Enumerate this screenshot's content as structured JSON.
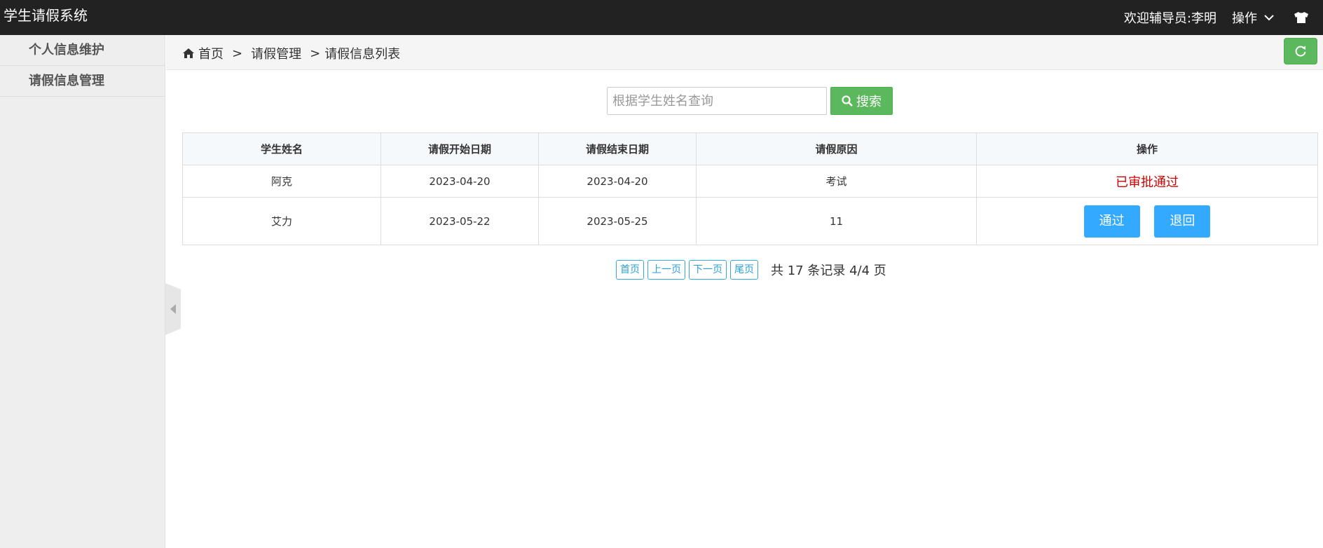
{
  "app": {
    "title": "学生请假系统"
  },
  "topbar": {
    "welcome": "欢迎辅导员:李明",
    "ops_label": "操作",
    "ops_icon": "chevron-down-icon",
    "theme_icon": "tshirt-icon"
  },
  "sidebar": {
    "items": [
      {
        "label": "个人信息维护"
      },
      {
        "label": "请假信息管理"
      }
    ]
  },
  "breadcrumb": {
    "home": "首页",
    "sep1": ">",
    "level2": "请假管理",
    "sep2": ">",
    "level3": "请假信息列表"
  },
  "search": {
    "placeholder": "根据学生姓名查询",
    "value": "",
    "button_label": "搜索"
  },
  "table": {
    "headers": [
      "学生姓名",
      "请假开始日期",
      "请假结束日期",
      "请假原因",
      "操作"
    ],
    "rows": [
      {
        "name": "阿克",
        "start": "2023-04-20",
        "end": "2023-04-20",
        "reason": "考试",
        "status": "已审批通过"
      },
      {
        "name": "艾力",
        "start": "2023-05-22",
        "end": "2023-05-25",
        "reason": "11",
        "approve": "通过",
        "reject": "退回"
      }
    ]
  },
  "pagination": {
    "first": "首页",
    "prev": "上一页",
    "next": "下一页",
    "last": "尾页",
    "info": "共 17 条记录 4/4 页"
  },
  "colors": {
    "topbar": "#222222",
    "green": "#5cb85c",
    "blue": "#33aaff",
    "red": "#d00000"
  }
}
